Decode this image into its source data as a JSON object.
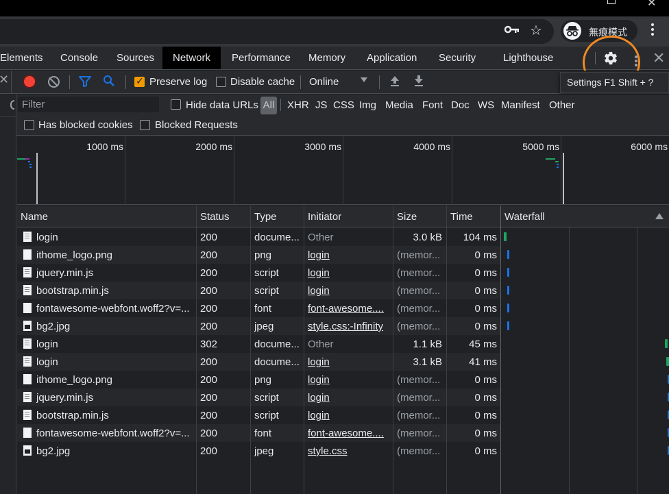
{
  "browser": {
    "incognito_label": "無痕模式"
  },
  "devtools": {
    "tabs": [
      "Elements",
      "Console",
      "Sources",
      "Network",
      "Performance",
      "Memory",
      "Application",
      "Security",
      "Lighthouse"
    ],
    "active_tab": "Network"
  },
  "toolbar": {
    "preserve_log_label": "Preserve log",
    "preserve_log_checked": true,
    "disable_cache_label": "Disable cache",
    "disable_cache_checked": false,
    "throttling_value": "Online",
    "tooltip": "Settings   F1   Shift + ?"
  },
  "filter": {
    "placeholder": "Filter",
    "hide_data_urls_label": "Hide data URLs",
    "all_label": "All",
    "types": [
      "XHR",
      "JS",
      "CSS",
      "Img",
      "Media",
      "Font",
      "Doc",
      "WS",
      "Manifest",
      "Other"
    ],
    "has_blocked_cookies_label": "Has blocked cookies",
    "blocked_requests_label": "Blocked Requests"
  },
  "overview": {
    "ticks": [
      "1000 ms",
      "2000 ms",
      "3000 ms",
      "4000 ms",
      "5000 ms",
      "6000 ms"
    ]
  },
  "table": {
    "columns": {
      "name": "Name",
      "status": "Status",
      "type": "Type",
      "initiator": "Initiator",
      "size": "Size",
      "time": "Time",
      "waterfall": "Waterfall"
    },
    "rows": [
      {
        "name": "login",
        "status": "200",
        "type": "docume...",
        "initiator": "Other",
        "size": "3.0 kB",
        "time": "104 ms"
      },
      {
        "name": "ithome_logo.png",
        "status": "200",
        "type": "png",
        "initiator": "login",
        "size": "(memor...",
        "time": "0 ms"
      },
      {
        "name": "jquery.min.js",
        "status": "200",
        "type": "script",
        "initiator": "login",
        "size": "(memor...",
        "time": "0 ms"
      },
      {
        "name": "bootstrap.min.js",
        "status": "200",
        "type": "script",
        "initiator": "login",
        "size": "(memor...",
        "time": "0 ms"
      },
      {
        "name": "fontawesome-webfont.woff2?v=...",
        "status": "200",
        "type": "font",
        "initiator": "font-awesome....",
        "size": "(memor...",
        "time": "0 ms"
      },
      {
        "name": "bg2.jpg",
        "status": "200",
        "type": "jpeg",
        "initiator": "style.css:-Infinity",
        "size": "(memor...",
        "time": "0 ms"
      },
      {
        "name": "login",
        "status": "302",
        "type": "docume...",
        "initiator": "Other",
        "size": "1.1 kB",
        "time": "45 ms"
      },
      {
        "name": "login",
        "status": "200",
        "type": "docume...",
        "initiator": "login",
        "size": "3.1 kB",
        "time": "41 ms"
      },
      {
        "name": "ithome_logo.png",
        "status": "200",
        "type": "png",
        "initiator": "login",
        "size": "(memor...",
        "time": "0 ms"
      },
      {
        "name": "jquery.min.js",
        "status": "200",
        "type": "script",
        "initiator": "login",
        "size": "(memor...",
        "time": "0 ms"
      },
      {
        "name": "bootstrap.min.js",
        "status": "200",
        "type": "script",
        "initiator": "login",
        "size": "(memor...",
        "time": "0 ms"
      },
      {
        "name": "fontawesome-webfont.woff2?v=...",
        "status": "200",
        "type": "font",
        "initiator": "font-awesome....",
        "size": "(memor...",
        "time": "0 ms"
      },
      {
        "name": "bg2.jpg",
        "status": "200",
        "type": "jpeg",
        "initiator": "style.css",
        "size": "(memor...",
        "time": "0 ms"
      }
    ]
  },
  "colors": {
    "record_red": "#f44336",
    "accent_blue": "#1a73e8",
    "checkbox_orange": "#f29900",
    "highlight_ring": "#f08a24",
    "waterfall_green": "#1ea362",
    "waterfall_blue": "#1a73e8"
  }
}
